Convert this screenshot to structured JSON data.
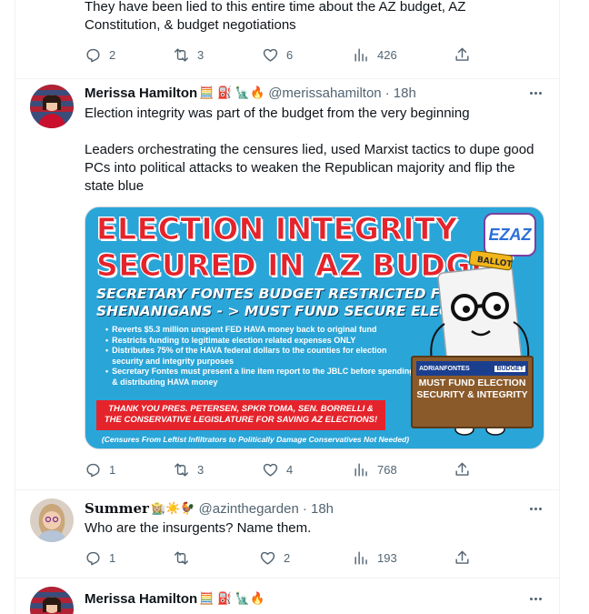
{
  "tweet0": {
    "text": "They have been lied to this entire time about the AZ budget, AZ Constitution, & budget negotiations",
    "replies": "2",
    "retweets": "3",
    "likes": "6",
    "views": "426"
  },
  "tweet1": {
    "name": "Merissa Hamilton",
    "emojis": "🧮 ⛽ 🗽🔥",
    "handle": "@merissahamilton",
    "time": "· 18h",
    "text": "Election integrity was part of the budget from the very beginning\n\nLeaders orchestrating the censures lied, used Marxist tactics to dupe good PCs into political attacks to weaken the Republican majority and flip the state blue",
    "image": {
      "title_line1": "ELECTION INTEGRITY",
      "title_line2": "SECURED IN AZ BUDGET",
      "subtitle_line1": "SECRETARY FONTES BUDGET RESTRICTED FROM",
      "subtitle_line2": "SHENANIGANS - > MUST FUND SECURE ELECTIONS",
      "bullets": [
        "Reverts $5.3 million unspent FED HAVA money back to original fund",
        "Restricts funding to legitimate election related expenses ONLY",
        "Distributes 75% of the HAVA federal dollars to the counties for election security and integrity purposes",
        "Secretary Fontes must present a line item report to the JBLC before spending & distributing HAVA money"
      ],
      "thanks": "THANK YOU PRES. PETERSEN, SPKR TOMA, SEN. BORRELLI & THE CONSERVATIVE LEGISLATURE FOR SAVING AZ ELECTIONS!",
      "footer": "(Censures From Leftist Infiltrators to Politically Damage Conservatives Not Needed)",
      "logo": "EZAZ",
      "ballot_label": "BALLOT",
      "sign_name": "ADRIANFONTES",
      "sign_badge": "BUDGET",
      "sign_text": "MUST FUND ELECTION SECURITY & INTEGRITY"
    },
    "replies": "1",
    "retweets": "3",
    "likes": "4",
    "views": "768"
  },
  "tweet2": {
    "name": "𝐒𝐮𝐦𝐦𝐞𝐫",
    "emojis": "👩🏼‍🌾☀️🐓",
    "handle": "@azinthegarden",
    "time": "· 18h",
    "text": "Who are the insurgents? Name them.",
    "replies": "1",
    "retweets": "",
    "likes": "2",
    "views": "193"
  },
  "tweet3": {
    "name": "Merissa Hamilton",
    "emojis": "🧮 ⛽ 🗽🔥"
  },
  "colors": {
    "text_primary": "#0f1419",
    "text_secondary": "#536471",
    "border": "#eff3f4",
    "image_bg": "#2aa5d8",
    "image_red": "#e5232b"
  },
  "icons": [
    "reply-icon",
    "retweet-icon",
    "like-icon",
    "views-icon",
    "share-icon",
    "more-icon"
  ]
}
